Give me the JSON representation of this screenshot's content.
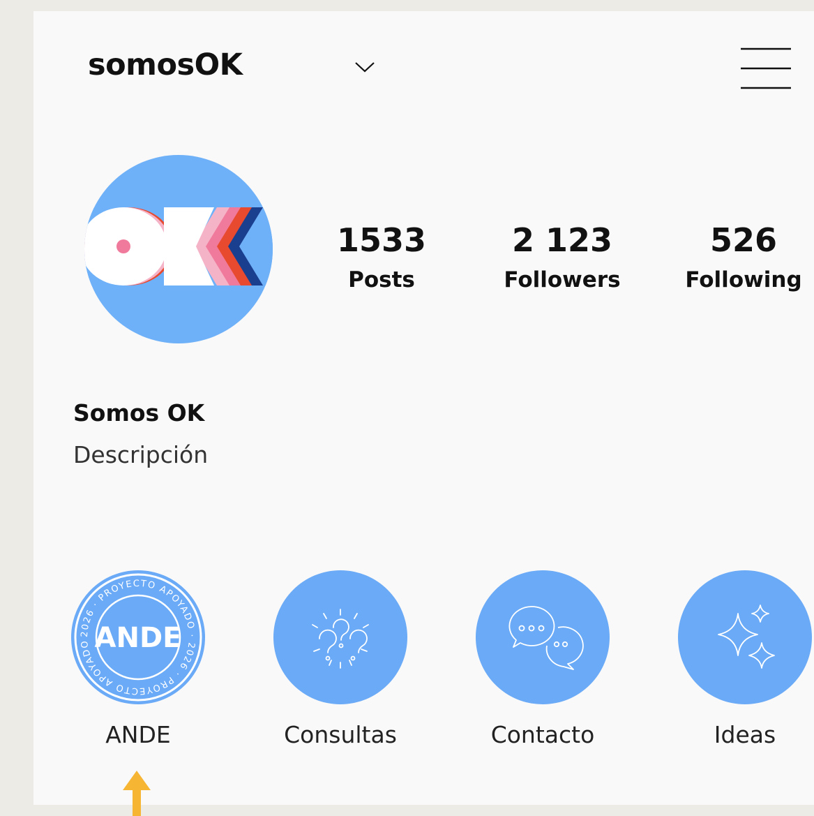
{
  "profile": {
    "username": "somosOK",
    "display_name": "Somos OK",
    "description": "Descripción",
    "avatar_text": "OK"
  },
  "stats": {
    "posts_count": "1533",
    "posts_label": "Posts",
    "followers_count": "2 123",
    "followers_label": "Followers",
    "following_count": "526",
    "following_label": "Following"
  },
  "highlights": [
    {
      "label": "ANDE",
      "icon": "ande-badge",
      "badge_text": "ANDE",
      "ring_text": "2026 · PROYECTO APOYADO · 2026 · PROYECTO APOYADO ·"
    },
    {
      "label": "Consultas",
      "icon": "question-bubbles-icon"
    },
    {
      "label": "Contacto",
      "icon": "chat-bubbles-icon"
    },
    {
      "label": "Ideas",
      "icon": "sparkles-icon"
    }
  ],
  "colors": {
    "highlight_blue": "#6aaaf6",
    "avatar_blue": "#6fb1f8",
    "arrow_yellow": "#f7b534",
    "background": "#f9f9f9"
  }
}
